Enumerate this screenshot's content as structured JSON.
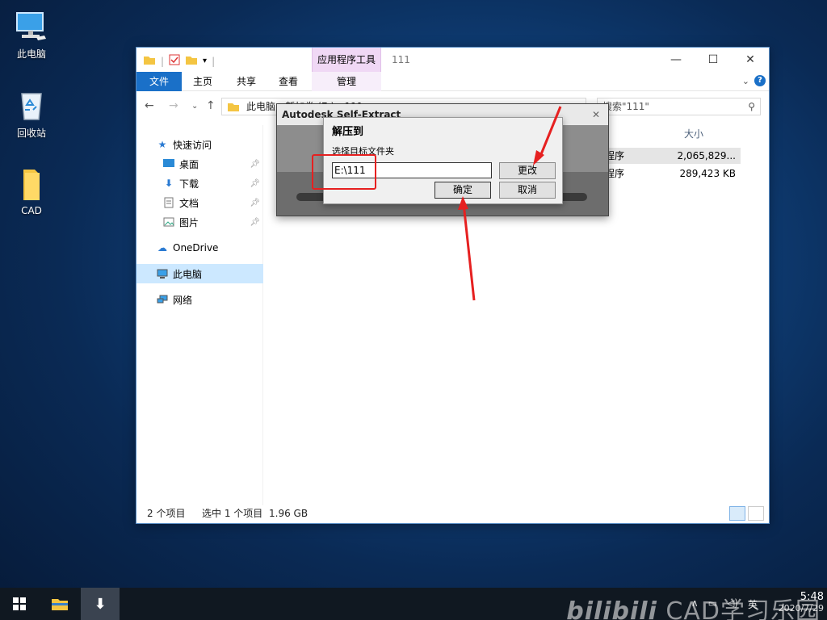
{
  "desktop": {
    "icons": [
      {
        "label": "此电脑",
        "icon": "computer-icon"
      },
      {
        "label": "回收站",
        "icon": "recycle-bin-icon"
      },
      {
        "label": "CAD",
        "icon": "folder-icon"
      }
    ]
  },
  "explorer": {
    "title": "111",
    "context_tab": "应用程序工具",
    "ribbon_tabs": {
      "file": "文件",
      "home": "主页",
      "share": "共享",
      "view": "查看",
      "manage": "管理"
    },
    "address_path": "此电脑 › 新加卷 (E:) › 111",
    "search_placeholder": "搜索\"111\"",
    "nav": {
      "quick_access": "快速访问",
      "desktop": "桌面",
      "downloads": "下载",
      "documents": "文档",
      "pictures": "图片",
      "onedrive": "OneDrive",
      "this_pc": "此电脑",
      "network": "网络"
    },
    "column_size": "大小",
    "files": [
      {
        "type": "程序",
        "size": "2,065,829..."
      },
      {
        "type": "程序",
        "size": "289,423 KB"
      }
    ],
    "status": {
      "items": "2 个项目",
      "selected": "选中 1 个项目",
      "size": "1.96 GB"
    }
  },
  "autodesk_dialog": {
    "title": "Autodesk Self-Extract",
    "close": "✕"
  },
  "extract_dialog": {
    "title": "解压到",
    "label": "选择目标文件夹",
    "path": "E:\\111",
    "change_button": "更改",
    "ok_button": "确定",
    "cancel_button": "取消"
  },
  "taskbar": {
    "time": "5:48",
    "date": "2020/7/29",
    "ime": "英",
    "watermark_brand": "bilibili",
    "watermark_text": "CAD学习乐园"
  },
  "colors": {
    "accent": "#1a70c8",
    "highlight_red": "#e62020",
    "context_tab": "#f0d8f5"
  }
}
